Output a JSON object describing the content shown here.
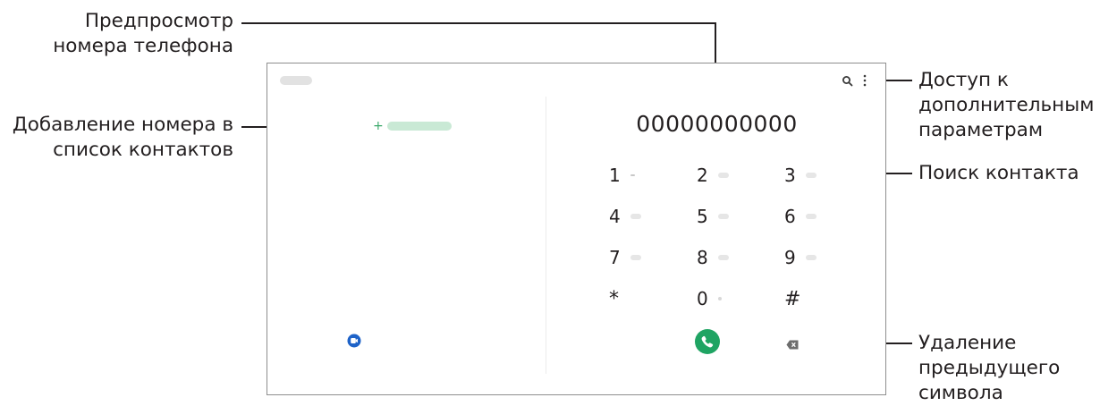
{
  "callouts": {
    "number_preview": [
      "Предпросмотр",
      "номера телефона"
    ],
    "add_to_contacts": [
      "Добавление номера в",
      "список контактов"
    ],
    "more_options": [
      "Доступ к",
      "дополнительным",
      "параметрам"
    ],
    "search_contact": [
      "Поиск контакта"
    ],
    "delete_previous": [
      "Удаление",
      "предыдущего",
      "символа"
    ]
  },
  "dialer": {
    "number": "00000000000",
    "keys": [
      {
        "digit": "1"
      },
      {
        "digit": "2"
      },
      {
        "digit": "3"
      },
      {
        "digit": "4"
      },
      {
        "digit": "5"
      },
      {
        "digit": "6"
      },
      {
        "digit": "7"
      },
      {
        "digit": "8"
      },
      {
        "digit": "9"
      },
      {
        "digit": "*"
      },
      {
        "digit": "0"
      },
      {
        "digit": "#"
      }
    ],
    "icons": {
      "search": "search-icon",
      "more": "more-vertical-icon",
      "add": "plus-icon",
      "video": "video-call-icon",
      "call": "phone-icon",
      "backspace": "backspace-icon"
    }
  },
  "colors": {
    "call_green": "#1fa463",
    "video_blue": "#1e63c8",
    "add_green": "#3aa86a",
    "text": "#231f20",
    "frame": "#8e8e8e"
  }
}
